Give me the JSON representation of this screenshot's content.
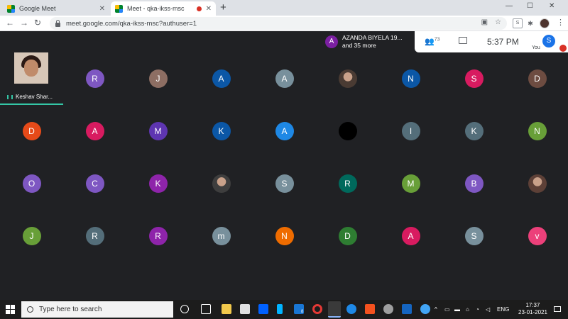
{
  "browser": {
    "tabs": [
      {
        "label": "Google Meet"
      },
      {
        "label": "Meet - qka-ikss-msc"
      }
    ],
    "url": "meet.google.com/qka-ikss-msc?authuser=1"
  },
  "meet": {
    "notification": {
      "avatar_letter": "A",
      "line1": "AZANDA BIYELA 19...",
      "line2": "and 35 more"
    },
    "participant_count": "73",
    "clock": "5:37 PM",
    "self_avatar": "S",
    "self_label": "You",
    "presenter_name": "Keshav Shar...",
    "grid": [
      {
        "letter": "",
        "color": ""
      },
      {
        "letter": "R",
        "color": "#7e57c2"
      },
      {
        "letter": "J",
        "color": "#8d6e63"
      },
      {
        "letter": "A",
        "color": "#0b57a6"
      },
      {
        "letter": "A",
        "color": "#78909c"
      },
      {
        "letter": "",
        "color": "photo"
      },
      {
        "letter": "N",
        "color": "#0b57a6"
      },
      {
        "letter": "S",
        "color": "#d81b60"
      },
      {
        "letter": "D",
        "color": "#6d4c41"
      },
      {
        "letter": "D",
        "color": "#e64a19"
      },
      {
        "letter": "A",
        "color": "#d81b60"
      },
      {
        "letter": "M",
        "color": "#5e35b1"
      },
      {
        "letter": "K",
        "color": "#0b57a6"
      },
      {
        "letter": "A",
        "color": "#1e88e5"
      },
      {
        "letter": "",
        "color": "#000000"
      },
      {
        "letter": "I",
        "color": "#546e7a"
      },
      {
        "letter": "K",
        "color": "#546e7a"
      },
      {
        "letter": "N",
        "color": "#689f38"
      },
      {
        "letter": "O",
        "color": "#7e57c2"
      },
      {
        "letter": "C",
        "color": "#7e57c2"
      },
      {
        "letter": "K",
        "color": "#8e24aa"
      },
      {
        "letter": "",
        "color": "photo"
      },
      {
        "letter": "S",
        "color": "#78909c"
      },
      {
        "letter": "R",
        "color": "#00695c"
      },
      {
        "letter": "M",
        "color": "#689f38"
      },
      {
        "letter": "B",
        "color": "#7e57c2"
      },
      {
        "letter": "",
        "color": "photo"
      },
      {
        "letter": "J",
        "color": "#689f38"
      },
      {
        "letter": "R",
        "color": "#546e7a"
      },
      {
        "letter": "R",
        "color": "#8e24aa"
      },
      {
        "letter": "m",
        "color": "#78909c"
      },
      {
        "letter": "N",
        "color": "#ef6c00"
      },
      {
        "letter": "D",
        "color": "#2e7d32"
      },
      {
        "letter": "A",
        "color": "#d81b60"
      },
      {
        "letter": "S",
        "color": "#78909c"
      },
      {
        "letter": "v",
        "color": "#ec407a"
      }
    ]
  },
  "taskbar": {
    "search_placeholder": "Type here to search",
    "lang": "ENG",
    "time": "17:37",
    "date": "23-01-2021",
    "badge": "8"
  }
}
